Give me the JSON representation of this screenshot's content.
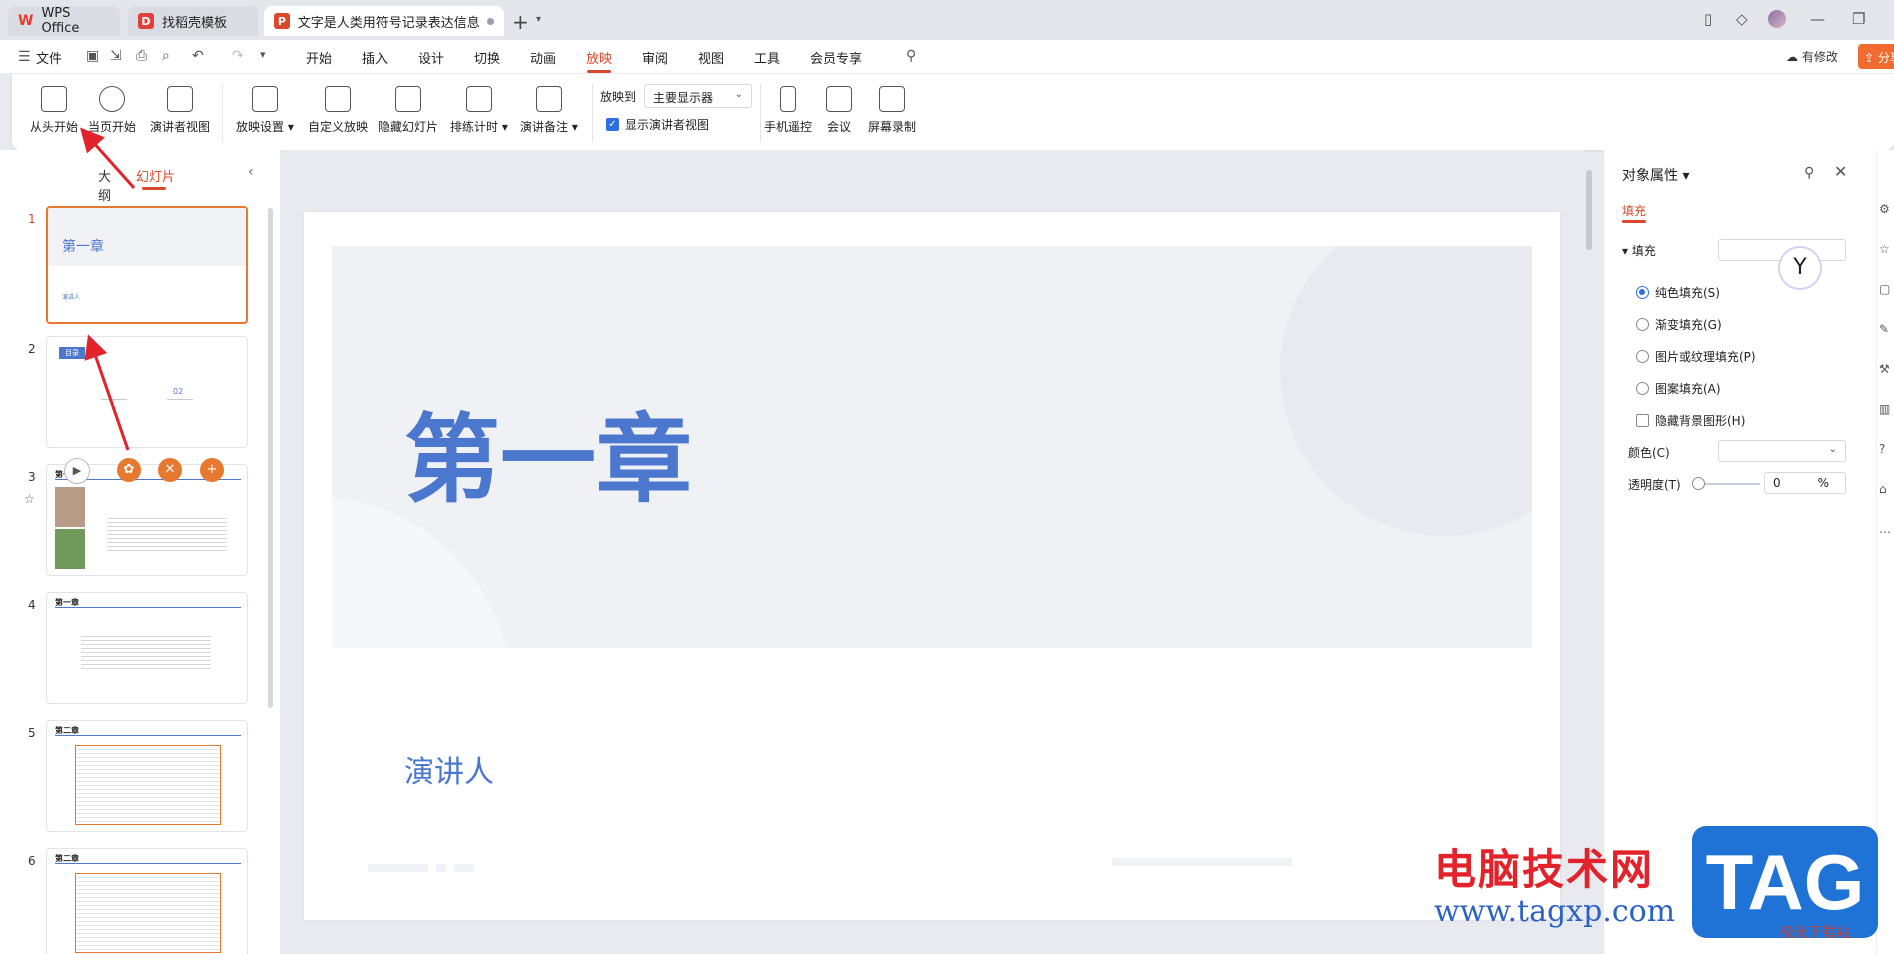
{
  "tabs": [
    {
      "label": "WPS Office"
    },
    {
      "label": "找稻壳模板"
    },
    {
      "label": "文字是人类用符号记录表达信息以"
    }
  ],
  "menu": {
    "file": "文件",
    "items": [
      "开始",
      "插入",
      "设计",
      "切换",
      "动画",
      "放映",
      "审阅",
      "视图",
      "工具",
      "会员专享"
    ],
    "active": "放映",
    "modified": "有修改",
    "share": "分享"
  },
  "ribbon": {
    "from_start": "从头开始",
    "from_current": "当页开始",
    "presenter_view": "演讲者视图",
    "show_settings": "放映设置",
    "custom_show": "自定义放映",
    "hide_slide": "隐藏幻灯片",
    "rehearse": "排练计时",
    "speaker_notes": "演讲备注",
    "play_to": "放映到",
    "monitor": "主要显示器",
    "show_presenter_view": "显示演讲者视图",
    "phone_remote": "手机遥控",
    "meeting": "会议",
    "screen_record": "屏幕录制"
  },
  "slide_panel": {
    "tab_outline": "大纲",
    "tab_slides": "幻灯片",
    "slides": [
      {
        "num": "1",
        "title": "第一章",
        "subtitle": "演讲人"
      },
      {
        "num": "2",
        "title": "目录",
        "subtitle": "02"
      },
      {
        "num": "3",
        "title": "第一章"
      },
      {
        "num": "4",
        "title": "第一章"
      },
      {
        "num": "5",
        "title": "第二章"
      },
      {
        "num": "6",
        "title": "第二章"
      }
    ]
  },
  "slide": {
    "title": "第一章",
    "presenter": "演讲人"
  },
  "properties": {
    "title": "对象属性",
    "tab_fill": "填充",
    "section_fill": "填充",
    "options": [
      "纯色填充(S)",
      "渐变填充(G)",
      "图片或纹理填充(P)",
      "图案填充(A)"
    ],
    "selected_option": "纯色填充(S)",
    "hide_bg": "隐藏背景图形(H)",
    "color_label": "颜色(C)",
    "transparency_label": "透明度(T)",
    "transparency_value": "0",
    "transparency_unit": "%"
  },
  "watermark": {
    "text": "电脑技术网",
    "url": "www.tagxp.com",
    "tag": "TAG",
    "small": "极光下载站"
  },
  "colors": {
    "accent": "#d9482b",
    "slide_blue": "#4b77cf",
    "arrow_red": "#e2232b",
    "thumb_orange": "#e6792f"
  }
}
